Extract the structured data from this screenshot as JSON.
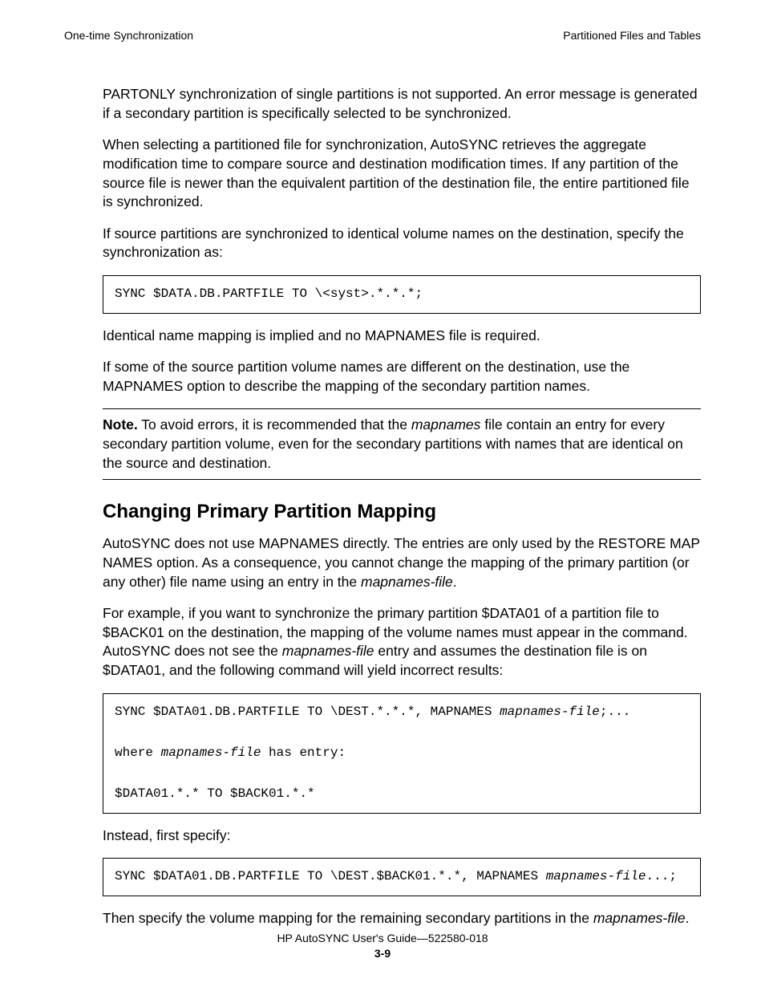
{
  "header": {
    "left": "One-time Synchronization",
    "right": "Partitioned Files and Tables"
  },
  "para1": "PARTONLY synchronization of single partitions is not supported. An error message is generated if a secondary partition is specifically selected to be synchronized.",
  "para2": "When selecting a partitioned file for synchronization, AutoSYNC retrieves the aggregate modification time to compare source and destination modification times. If any partition of the source file is newer than the equivalent partition of the destination file, the entire partitioned file is synchronized.",
  "para3": "If source partitions are synchronized to identical volume names on the destination, specify the synchronization as:",
  "code1": "SYNC $DATA.DB.PARTFILE TO \\<syst>.*.*.*;",
  "para4": "Identical name mapping is implied and no MAPNAMES file is required.",
  "para5": "If some of the source partition volume names are different on the destination, use the MAPNAMES option to describe the mapping of the secondary partition names.",
  "note": {
    "label": "Note.",
    "text_before": "To avoid errors, it is recommended that the ",
    "italic1": "mapnames",
    "text_after": " file contain an entry for every secondary partition volume, even for the secondary partitions with names that are identical on the source and destination."
  },
  "heading2": "Changing Primary Partition Mapping",
  "para6_a": "AutoSYNC does not use MAPNAMES directly. The entries are only used by the RESTORE MAP NAMES option. As a consequence, you cannot change the mapping of the primary partition (or any other) file name using an entry in the ",
  "para6_italic": "mapnames-file",
  "para6_b": ".",
  "para7_a": "For example, if you want to synchronize the primary partition $DATA01 of a partition file to $BACK01 on the destination, the mapping of the volume names must appear in the command. AutoSYNC does not see the ",
  "para7_italic": "mapnames-file",
  "para7_b": " entry and assumes the destination file is on $DATA01, and the following command will yield incorrect results:",
  "code2": {
    "line1a": "SYNC $DATA01.DB.PARTFILE TO \\DEST.*.*.*, MAPNAMES ",
    "line1b": "mapnames-file",
    "line1c": ";...",
    "line2a": "where ",
    "line2b": "mapnames-file",
    "line2c": " has entry:",
    "line3": "$DATA01.*.* TO $BACK01.*.*"
  },
  "para8": "Instead, first specify:",
  "code3": {
    "a": "SYNC $DATA01.DB.PARTFILE TO \\DEST.$BACK01.*.*, MAPNAMES ",
    "b": "mapnames-file",
    "c": "...;"
  },
  "para9_a": "Then specify the volume mapping for the remaining secondary partitions in the ",
  "para9_italic": "mapnames-file",
  "para9_b": ".",
  "footer": {
    "title": "HP AutoSYNC User's Guide—522580-018",
    "page": "3-9"
  }
}
